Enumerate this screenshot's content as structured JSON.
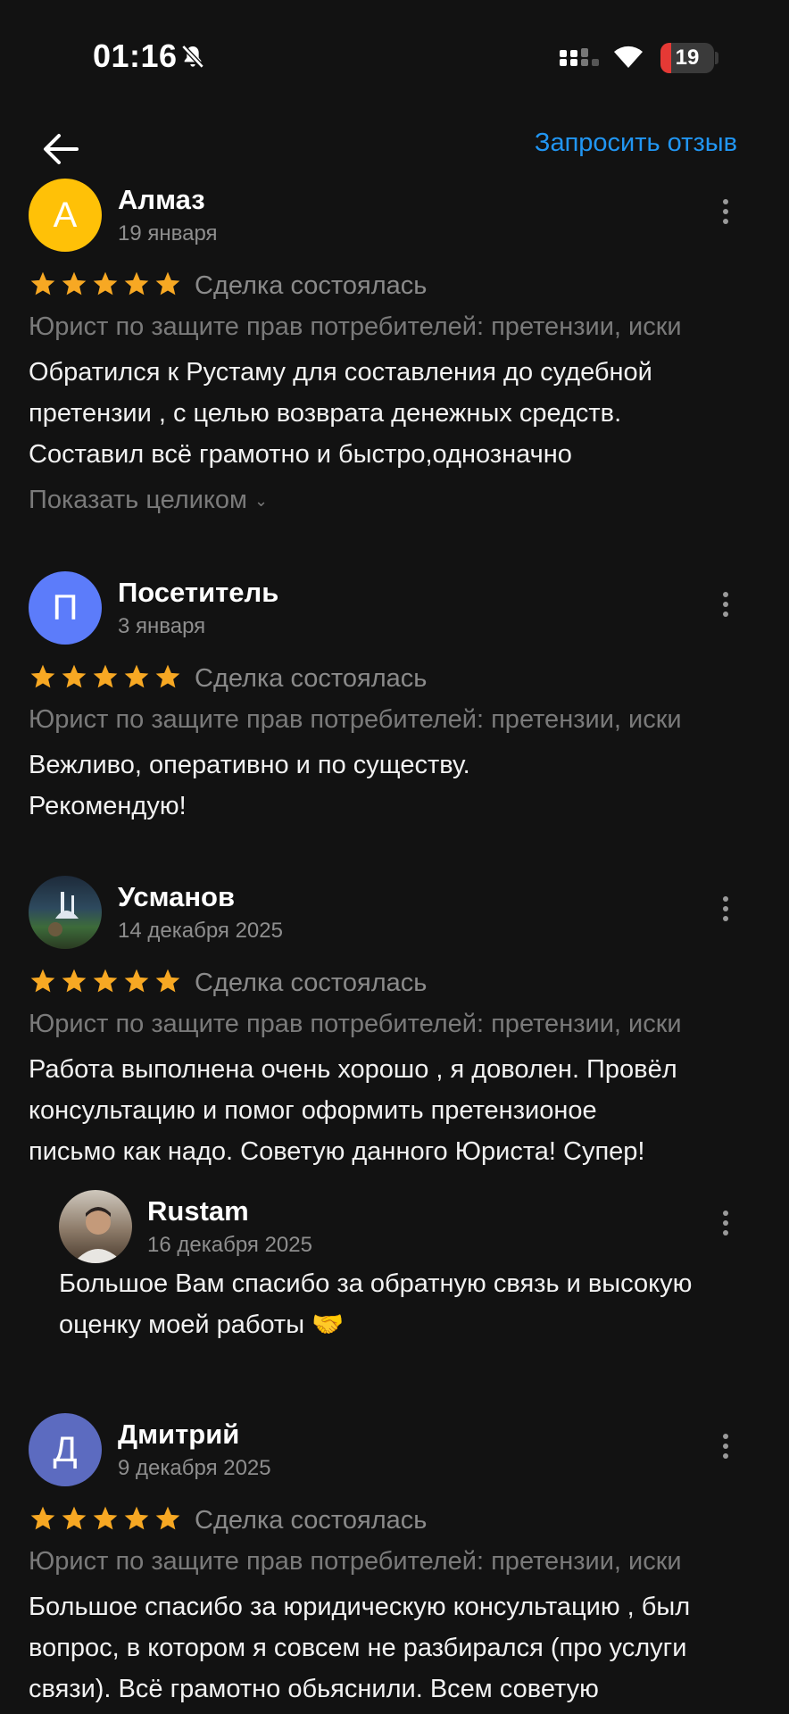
{
  "status": {
    "time": "01:16",
    "battery": "19"
  },
  "header": {
    "request_review": "Запросить отзыв"
  },
  "common": {
    "deal_status": "Сделка состоялась",
    "category": "Юрист по защите прав потребителей: претензии, иски",
    "show_more": "Показать целиком",
    "rating": 5
  },
  "colors": {
    "accent": "#2196f3",
    "star": "#f7a823",
    "avatar_a": "#ffc107",
    "avatar_p": "#5c7cfa",
    "avatar_d": "#5c6bc0"
  },
  "reviews": [
    {
      "initial": "А",
      "name": "Алмаз",
      "date": "19 января",
      "lines": [
        "Обратился к Рустаму для составления до судебной",
        "претензии , с целью возврата денежных средств.",
        "Составил всё грамотно и быстро,однозначно"
      ]
    },
    {
      "initial": "П",
      "name": "Посетитель",
      "date": "3 января",
      "lines": [
        "Вежливо, оперативно и по существу.",
        "Рекомендую!"
      ]
    },
    {
      "initial": "",
      "name": "Усманов",
      "date": "14 декабря 2025",
      "lines": [
        "Работа выполнена очень хорошо , я доволен. Провёл",
        "консультацию и помог оформить претензионое",
        "письмо как надо. Советую данного Юриста! Супер!"
      ],
      "reply": {
        "name": "Rustam",
        "date": "16 декабря 2025",
        "lines": [
          "Большое Вам спасибо за обратную связь и высокую",
          "оценку моей работы 🤝"
        ]
      }
    },
    {
      "initial": "Д",
      "name": "Дмитрий",
      "date": "9 декабря 2025",
      "lines": [
        "Большое спасибо за юридическую консультацию , был",
        "вопрос, в котором я совсем не разбирался (про услуги",
        "связи). Всё грамотно обьяснили. Всем советую"
      ]
    }
  ]
}
